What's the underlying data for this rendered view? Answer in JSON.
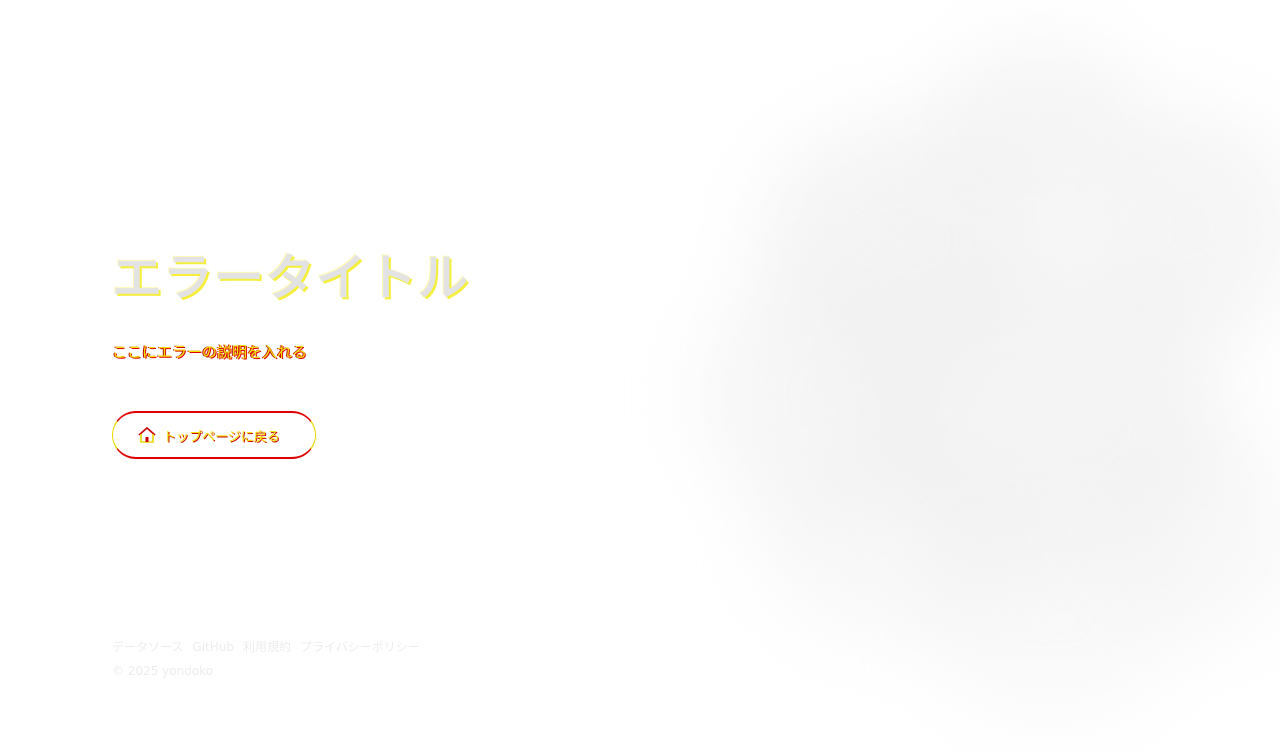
{
  "error": {
    "title": "エラータイトル",
    "description": "ここにエラーの説明を入れる"
  },
  "button": {
    "label": "トップページに戻る",
    "icon": "home-icon"
  },
  "footer": {
    "links": [
      "データソース",
      "GitHub",
      "利用規約",
      "プライバシーポリシー"
    ],
    "copyright": "© 2025 yondoko"
  },
  "colors": {
    "title": "#e3e3e3",
    "accent_yellow": "#f2e200",
    "accent_red": "#e00000",
    "footer_text": "#ececec"
  }
}
